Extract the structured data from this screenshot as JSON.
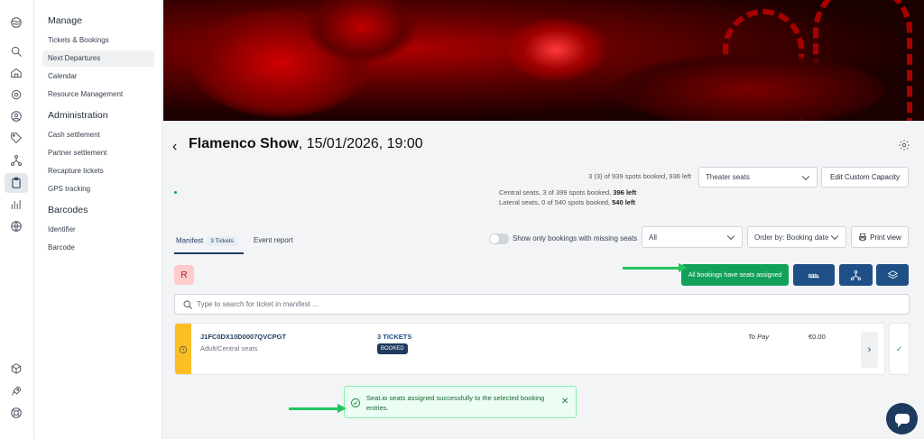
{
  "rail": {
    "icons": [
      "logo-icon",
      "search-icon",
      "home-icon",
      "settings-icon",
      "user-icon",
      "tag-icon",
      "network-icon",
      "clipboard-icon",
      "bar-chart-icon",
      "globe-icon",
      "box-icon",
      "rocket-icon",
      "lifebuoy-icon"
    ]
  },
  "subnav": {
    "sections": [
      {
        "heading": "Manage",
        "items": [
          "Tickets & Bookings",
          "Next Departures",
          "Calendar",
          "Resource Management"
        ]
      },
      {
        "heading": "Administration",
        "items": [
          "Cash settlement",
          "Partner settlement",
          "Recapture tickets",
          "GPS tracking"
        ]
      },
      {
        "heading": "Barcodes",
        "items": [
          "Identifier",
          "Barcode"
        ]
      }
    ],
    "selected": "Next Departures"
  },
  "header": {
    "title_bold": "Flamenco Show",
    "title_rest": ", 15/01/2026, 19:00"
  },
  "capacity": {
    "summary": "3 (3) of 939 spots booked, 936 left",
    "seat_type_value": "Theater seats",
    "edit_button": "Edit Custom Capacity",
    "central_label": "Central seats",
    "central_text": ", 3 of 399 spots booked, ",
    "central_left": "396 left",
    "lateral_label": "Lateral seats",
    "lateral_text": ", 0 of 540 spots booked, ",
    "lateral_left": "540 left"
  },
  "tabs": {
    "manifest": "Manifest",
    "manifest_count": "3 Tickets",
    "event_report": "Event report"
  },
  "filters": {
    "toggle_label": "Show only bookings with missing seats",
    "status_value": "All",
    "order_value": "Order by: Booking date",
    "print_label": "Print view"
  },
  "actions": {
    "avatar_letter": "R",
    "seats_assigned": "All bookings have seats assigned"
  },
  "search": {
    "placeholder": "Type to search for ticket in manifest ..."
  },
  "booking": {
    "code": "J1FC0DX10D0007QVCPGT",
    "detail": "Adult/Central seats",
    "tickets": "3 TICKETS",
    "status": "BOOKED",
    "payment": "To Pay",
    "amount": "€0.00"
  },
  "toast": {
    "message": "Seat.io seats assigned successfully to the selected booking entries."
  },
  "colors": {
    "navy": "#1e3a5f",
    "success": "#12a15a",
    "pending_stripe": "#fbbf24",
    "annotation_arrow": "#22c55e"
  }
}
